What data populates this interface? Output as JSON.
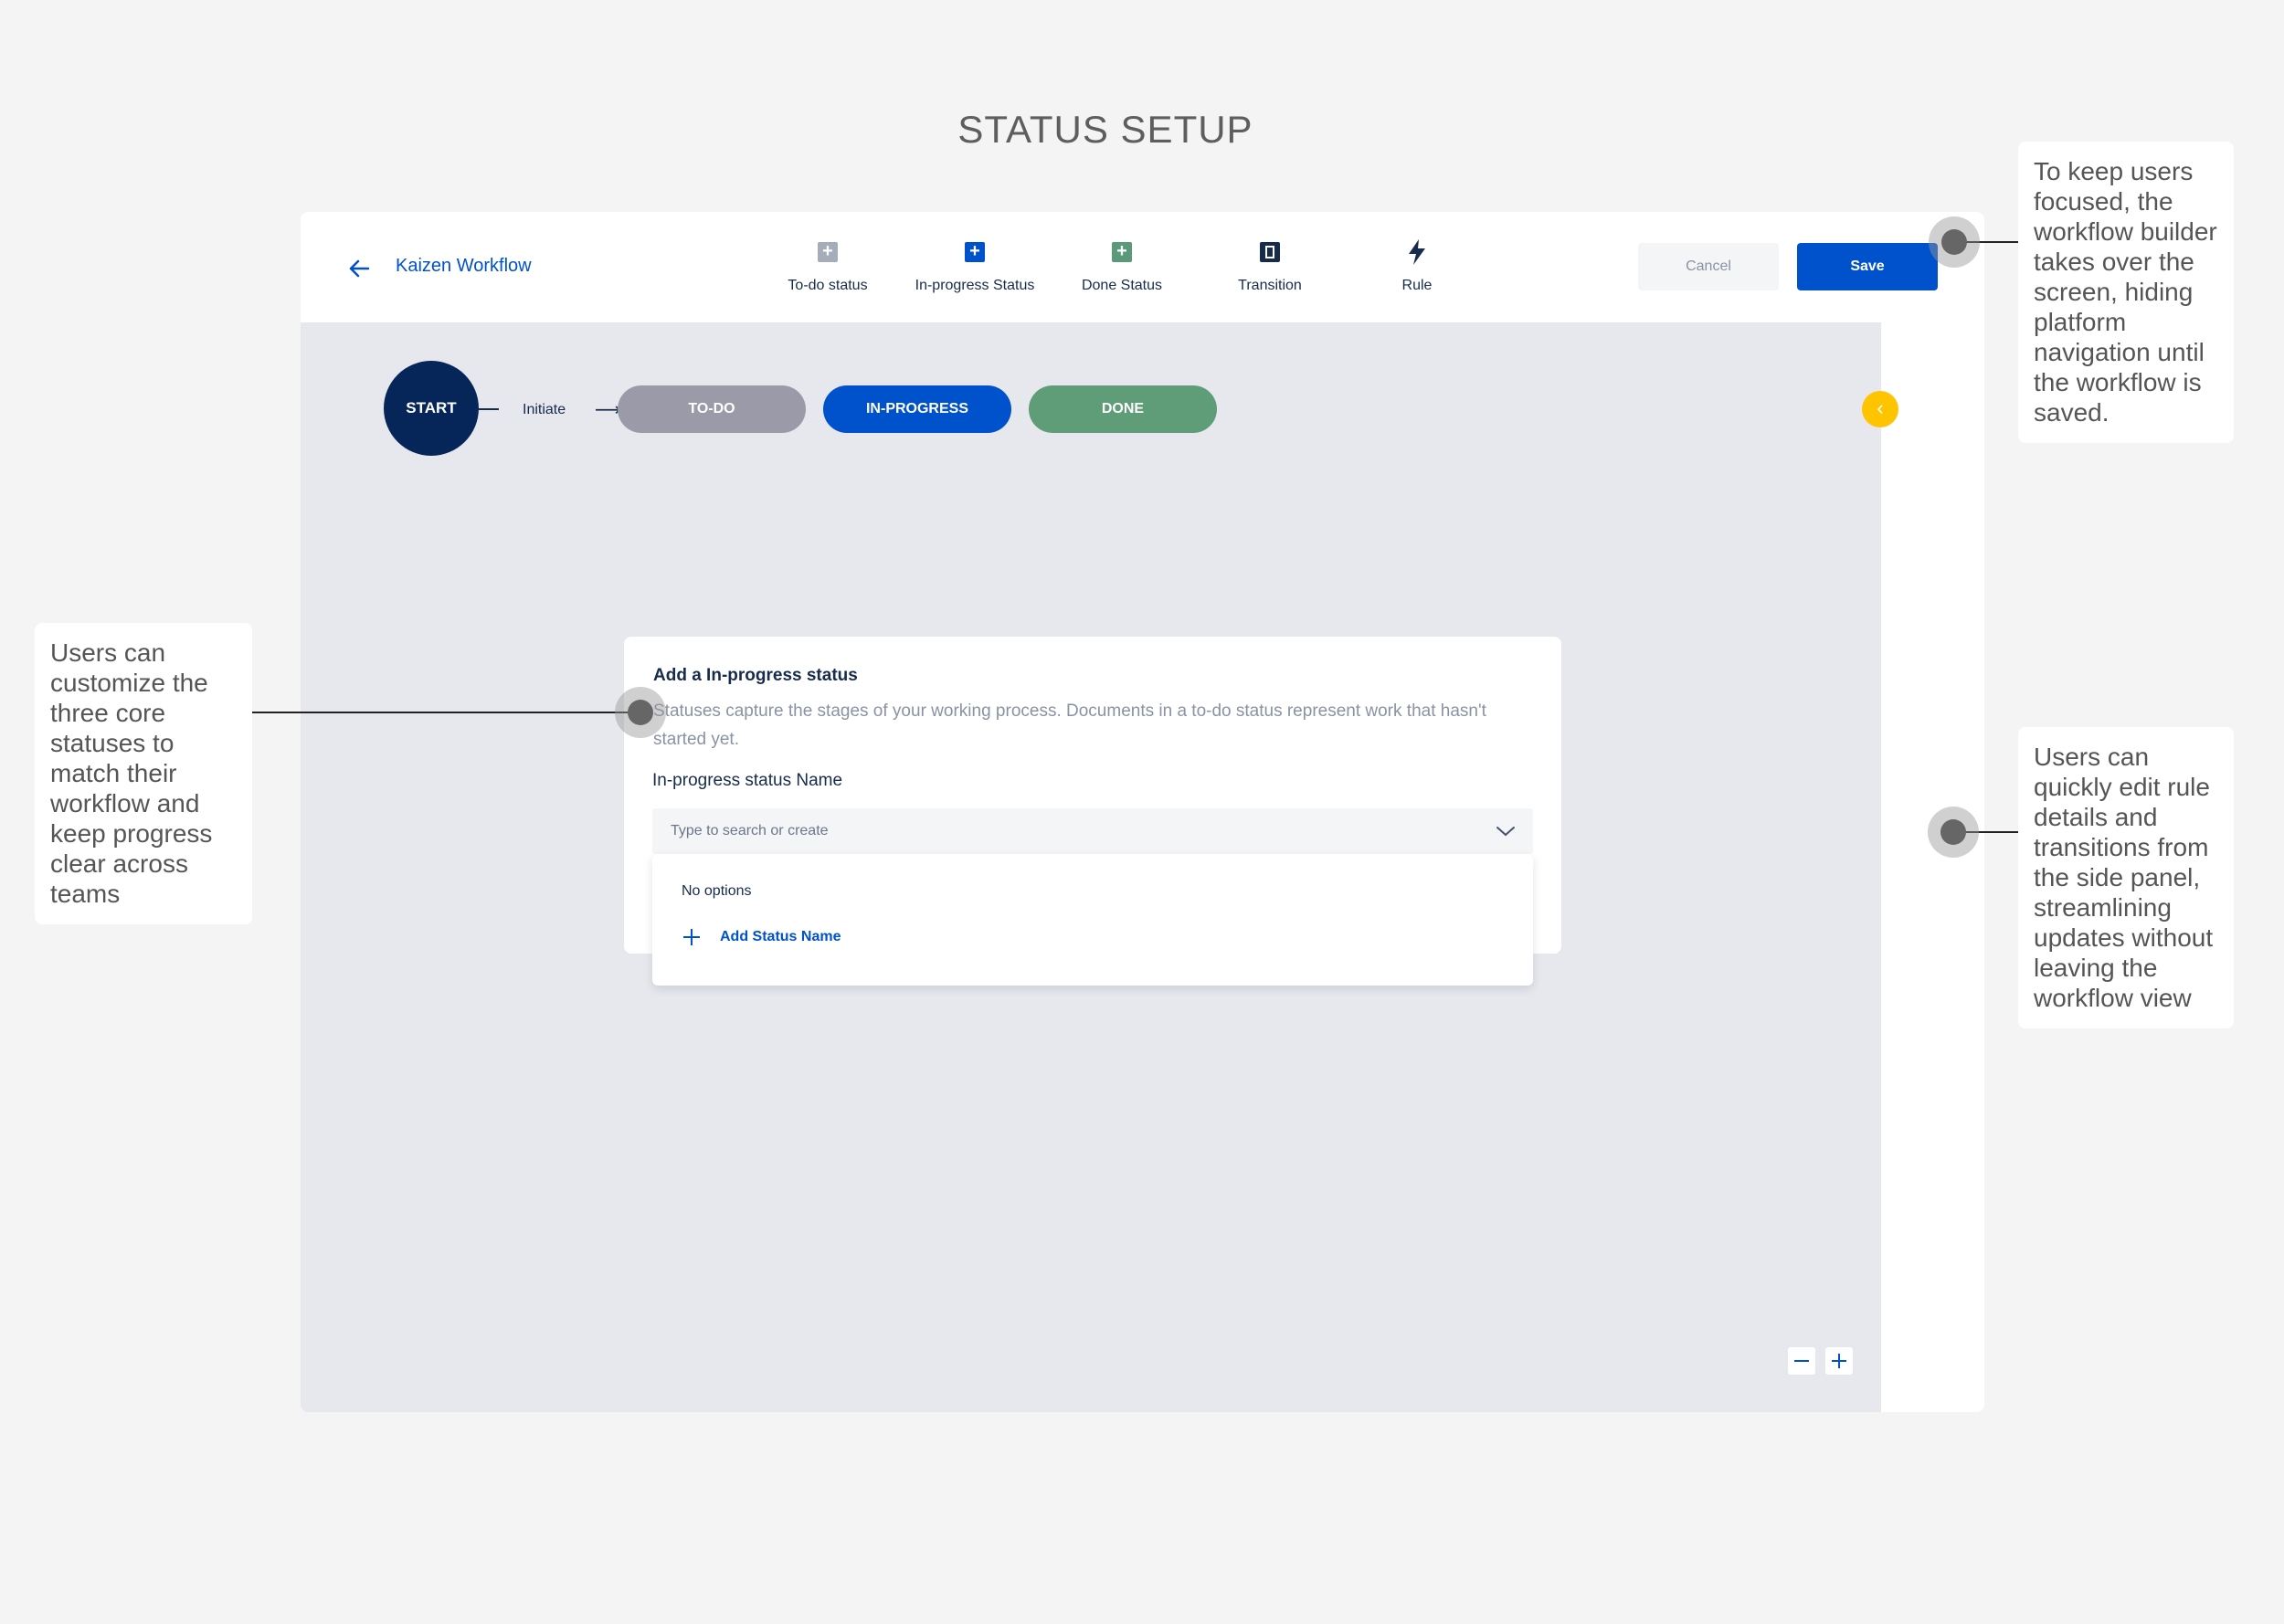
{
  "page": {
    "title": "STATUS SETUP"
  },
  "header": {
    "workflow_name": "Kaizen Workflow",
    "tools": [
      {
        "label": "To-do status",
        "icon": "plus-square-icon",
        "color": "#a5adba"
      },
      {
        "label": "In-progress Status",
        "icon": "plus-square-icon",
        "color": "#0052cc"
      },
      {
        "label": "Done Status",
        "icon": "plus-square-icon",
        "color": "#5a9a78"
      },
      {
        "label": "Transition",
        "icon": "transition-icon",
        "color": "#172b4d"
      },
      {
        "label": "Rule",
        "icon": "lightning-icon",
        "color": "#172b4d"
      }
    ],
    "cancel_label": "Cancel",
    "save_label": "Save"
  },
  "flow": {
    "start_label": "START",
    "initiate_label": "Initiate",
    "statuses": [
      {
        "label": "TO-DO",
        "color": "#9a9aa8"
      },
      {
        "label": "IN-PROGRESS",
        "color": "#0052cc"
      },
      {
        "label": "DONE",
        "color": "#5f9c78"
      }
    ]
  },
  "modal": {
    "title": "Add a In-progress status",
    "description": "Statuses capture the stages of your working process. Documents in a to-do status represent work that hasn't started yet.",
    "field_label": "In-progress status Name",
    "placeholder": "Type to search or create",
    "no_options": "No options",
    "add_label": "Add Status Name"
  },
  "annotations": {
    "top_right": "To keep users focused, the workflow builder takes over the screen, hiding platform navigation until the workflow is saved.",
    "left": "Users can customize the three core statuses to match their workflow and keep progress clear across teams",
    "right": "Users can quickly edit rule details and transitions from the side panel, streamlining updates without leaving the workflow view"
  },
  "colors": {
    "accent": "#0052cc",
    "warning": "#ffc400",
    "start": "#06265a"
  }
}
